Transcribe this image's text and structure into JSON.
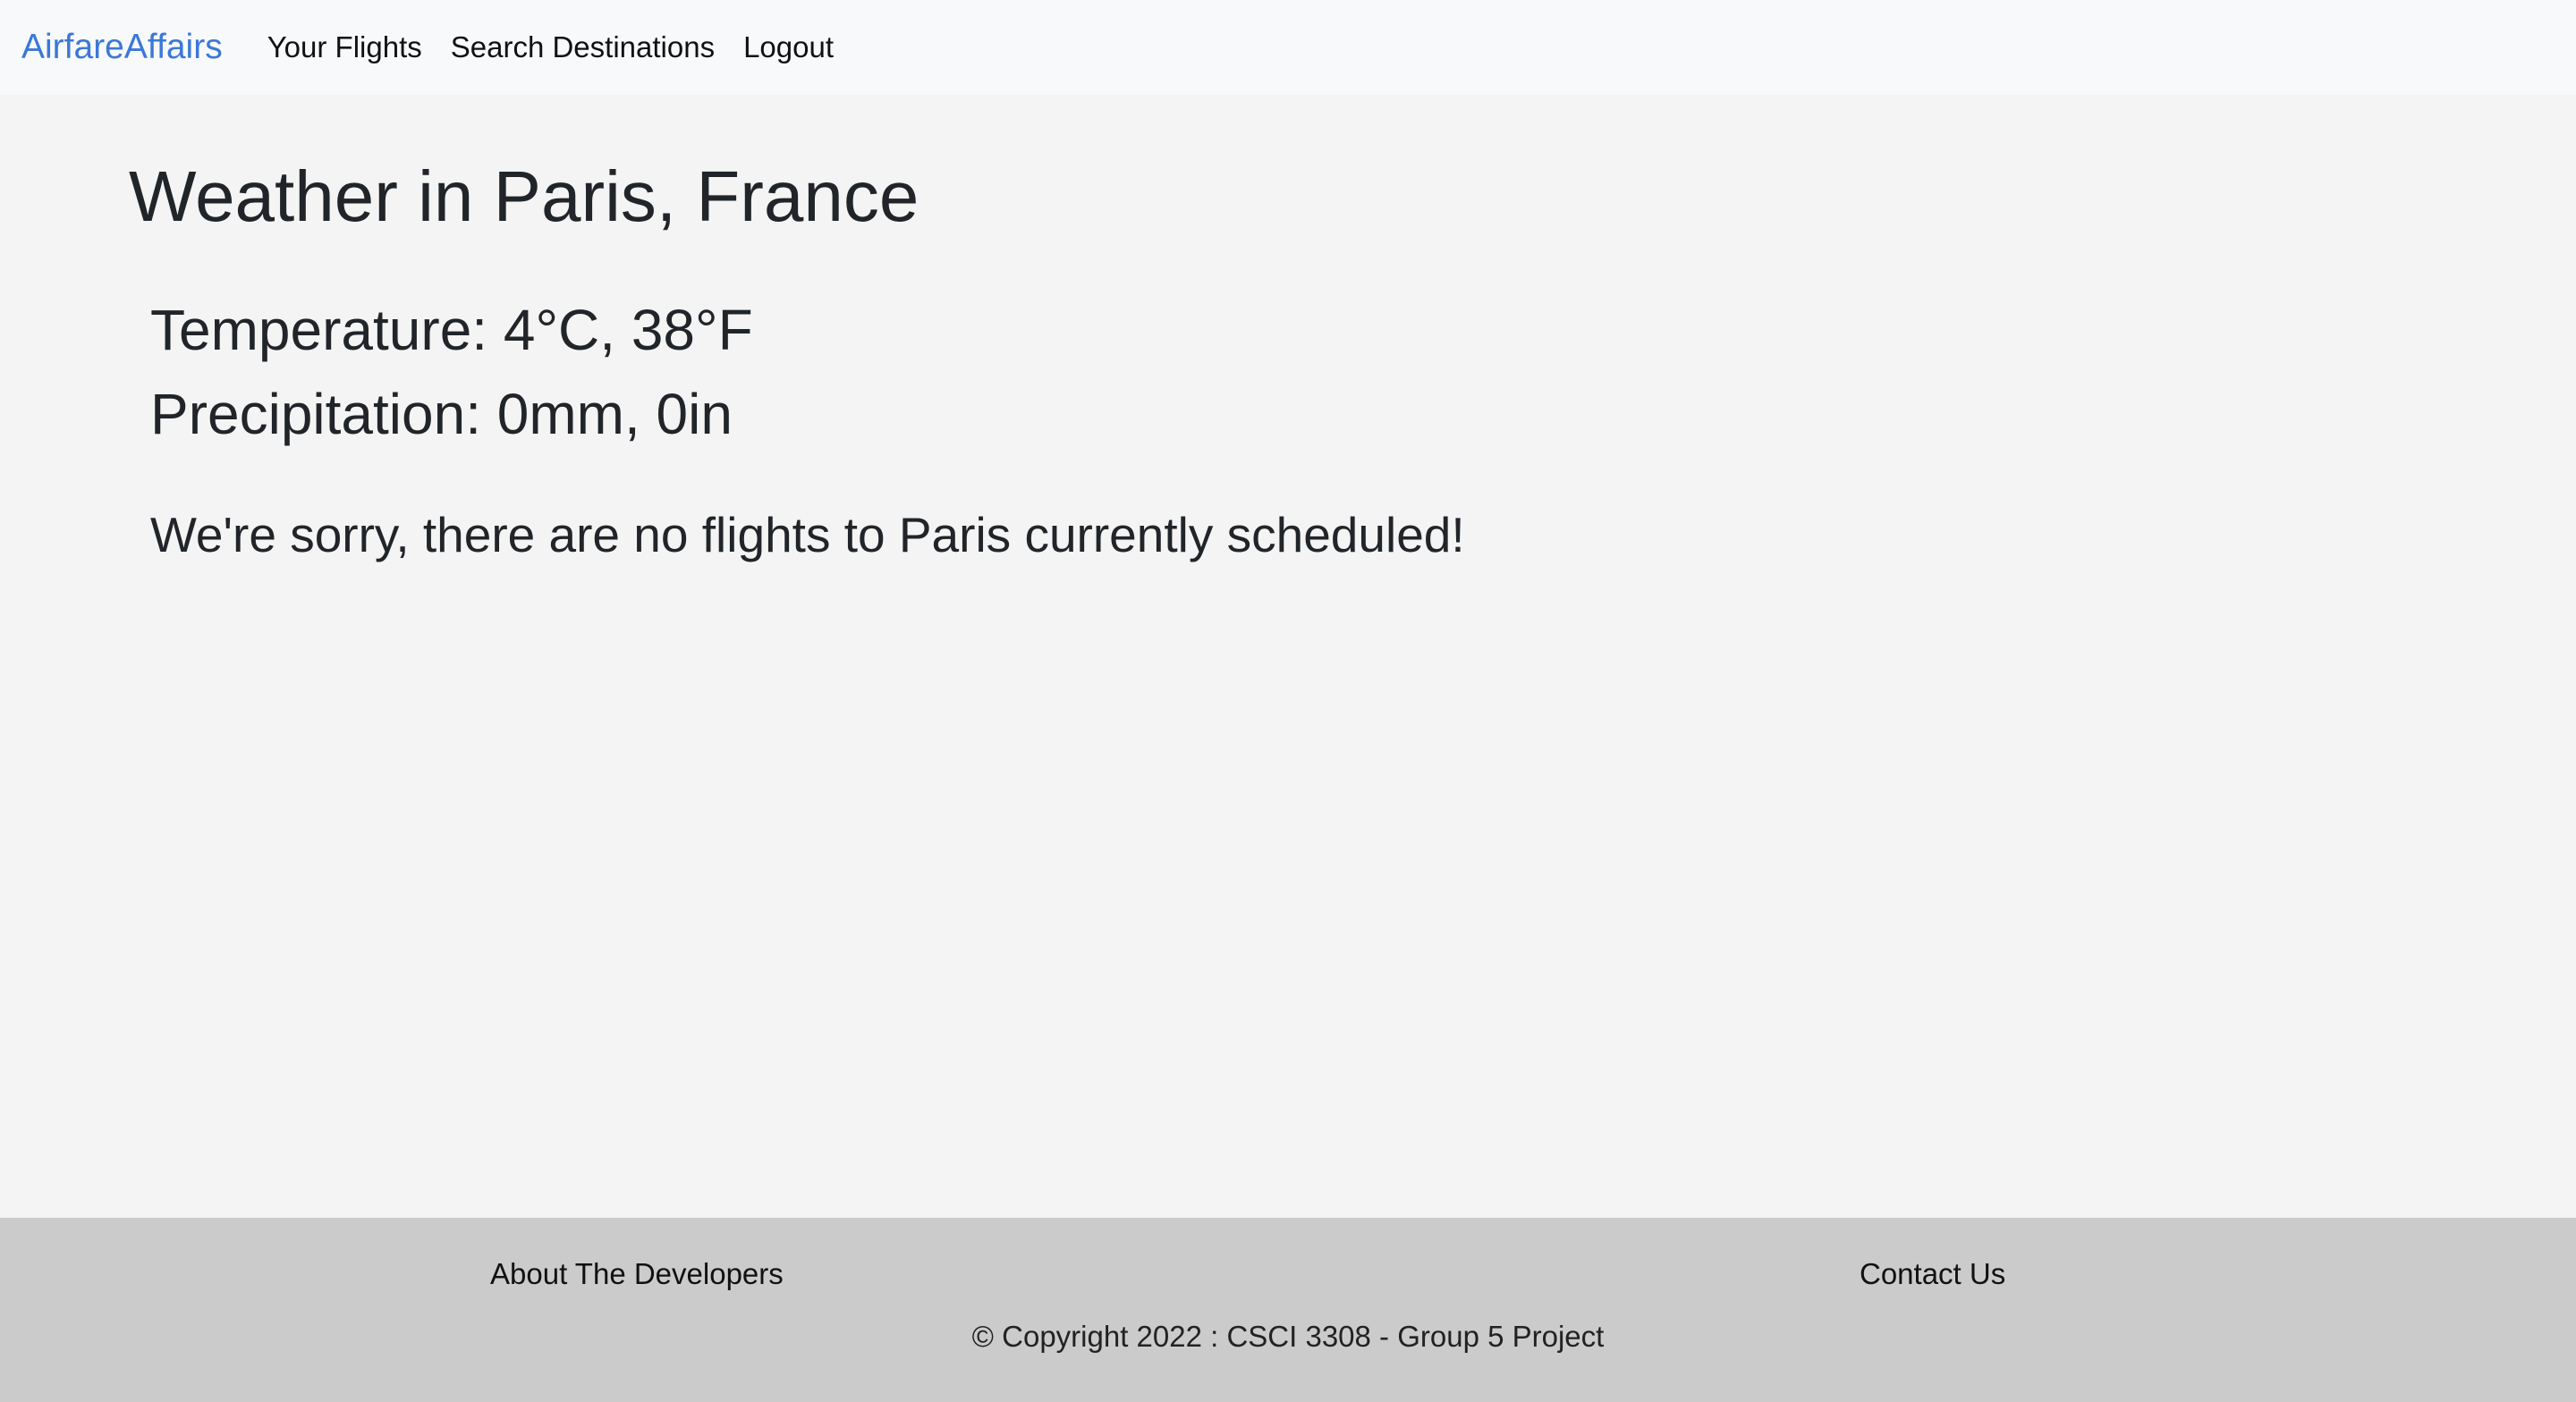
{
  "navbar": {
    "brand": "AirfareAffairs",
    "links": [
      "Your Flights",
      "Search Destinations",
      "Logout"
    ]
  },
  "main": {
    "title": "Weather in Paris, France",
    "temperature": "Temperature: 4°C, 38°F",
    "precipitation": "Precipitation: 0mm, 0in",
    "message": "We're sorry, there are no flights to Paris currently scheduled!"
  },
  "footer": {
    "about": "About The Developers",
    "contact": "Contact Us",
    "copyright": "© Copyright 2022 : CSCI 3308 - Group 5 Project"
  },
  "colors": {
    "brand": "#3a78d8",
    "navbar_bg": "#f8f9fa",
    "page_bg": "#f4f4f4",
    "footer_bg": "#cbcbcb",
    "text": "#212529"
  }
}
